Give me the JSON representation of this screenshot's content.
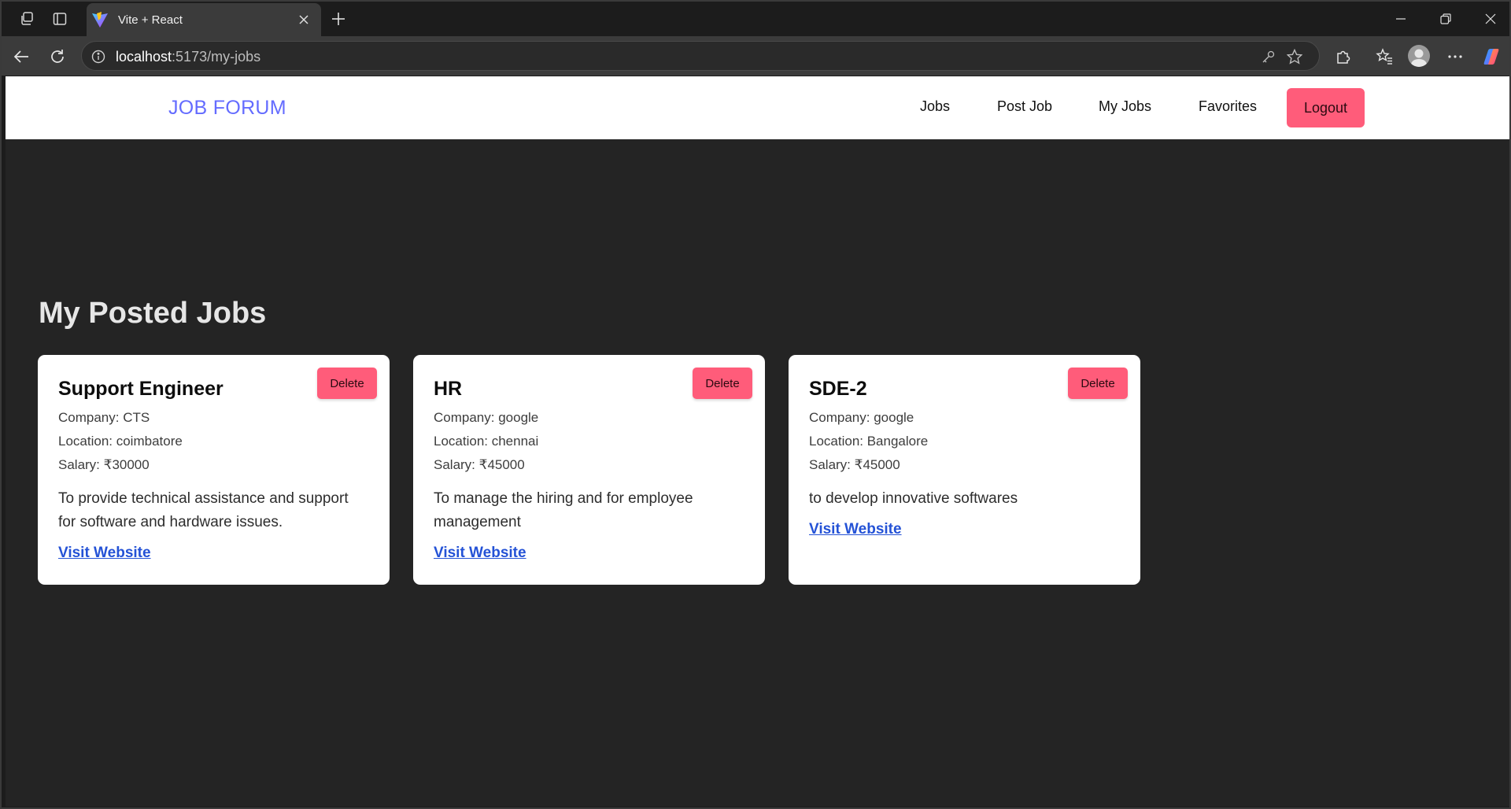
{
  "browser": {
    "tab_title": "Vite + React",
    "url_host": "localhost",
    "url_path": ":5173/my-jobs"
  },
  "navbar": {
    "brand": "JOB FORUM",
    "links": [
      "Jobs",
      "Post Job",
      "My Jobs",
      "Favorites"
    ],
    "logout_label": "Logout",
    "brand_color": "#646cff",
    "logout_color": "#ff5c7a"
  },
  "main": {
    "title": "My Posted Jobs",
    "jobs": [
      {
        "title": "Support Engineer",
        "delete_label": "Delete",
        "company": "Company: CTS",
        "location": "Location: coimbatore",
        "salary": "Salary: ₹30000",
        "description": "To provide technical assistance and support for software and hardware issues.",
        "link_label": "Visit Website"
      },
      {
        "title": "HR",
        "delete_label": "Delete",
        "company": "Company: google",
        "location": "Location: chennai",
        "salary": "Salary: ₹45000",
        "description": "To manage the hiring and for employee management",
        "link_label": "Visit Website"
      },
      {
        "title": "SDE-2",
        "delete_label": "Delete",
        "company": "Company: google",
        "location": "Location: Bangalore",
        "salary": "Salary: ₹45000",
        "description": "to develop innovative softwares",
        "link_label": "Visit Website"
      }
    ]
  }
}
